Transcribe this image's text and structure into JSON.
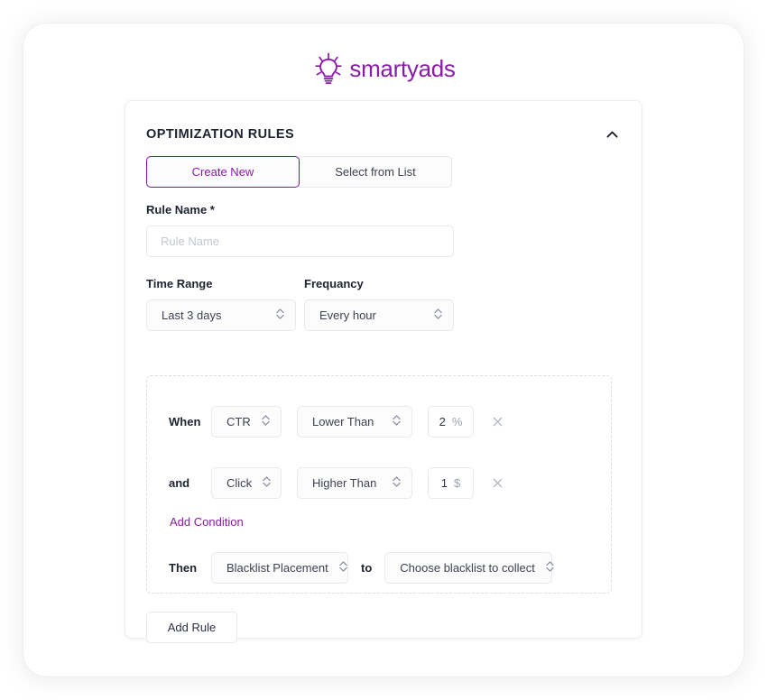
{
  "brand": {
    "name": "smartyads",
    "mark_icon": "lightbulb-icon",
    "color": "#8A1BA8"
  },
  "card": {
    "title": "OPTIMIZATION RULES",
    "collapse_icon": "chevron-up-icon",
    "tabs": [
      {
        "label": "Create New",
        "active": true
      },
      {
        "label": "Select from List",
        "active": false
      }
    ],
    "rule_name": {
      "label": "Rule Name *",
      "value": "",
      "placeholder": "Rule Name"
    },
    "time_range": {
      "label": "Time Range",
      "value": "Last 3 days",
      "stepper_icon": "chevron-up-down-icon"
    },
    "frequency": {
      "label": "Frequancy",
      "value": "Every hour",
      "stepper_icon": "chevron-up-down-icon"
    },
    "conditions": [
      {
        "conjunction": "When",
        "metric": "CTR",
        "operator": "Lower Than",
        "value": "2",
        "unit": "%",
        "remove_icon": "close-icon"
      },
      {
        "conjunction": "and",
        "metric": "Click",
        "operator": "Higher Than",
        "value": "1",
        "unit": "$",
        "remove_icon": "close-icon"
      }
    ],
    "add_condition_label": "Add Condition",
    "then": {
      "label": "Then",
      "action": "Blacklist Placement",
      "connector": "to",
      "target": "Choose blacklist to collect"
    },
    "add_rule_label": "Add Rule"
  }
}
